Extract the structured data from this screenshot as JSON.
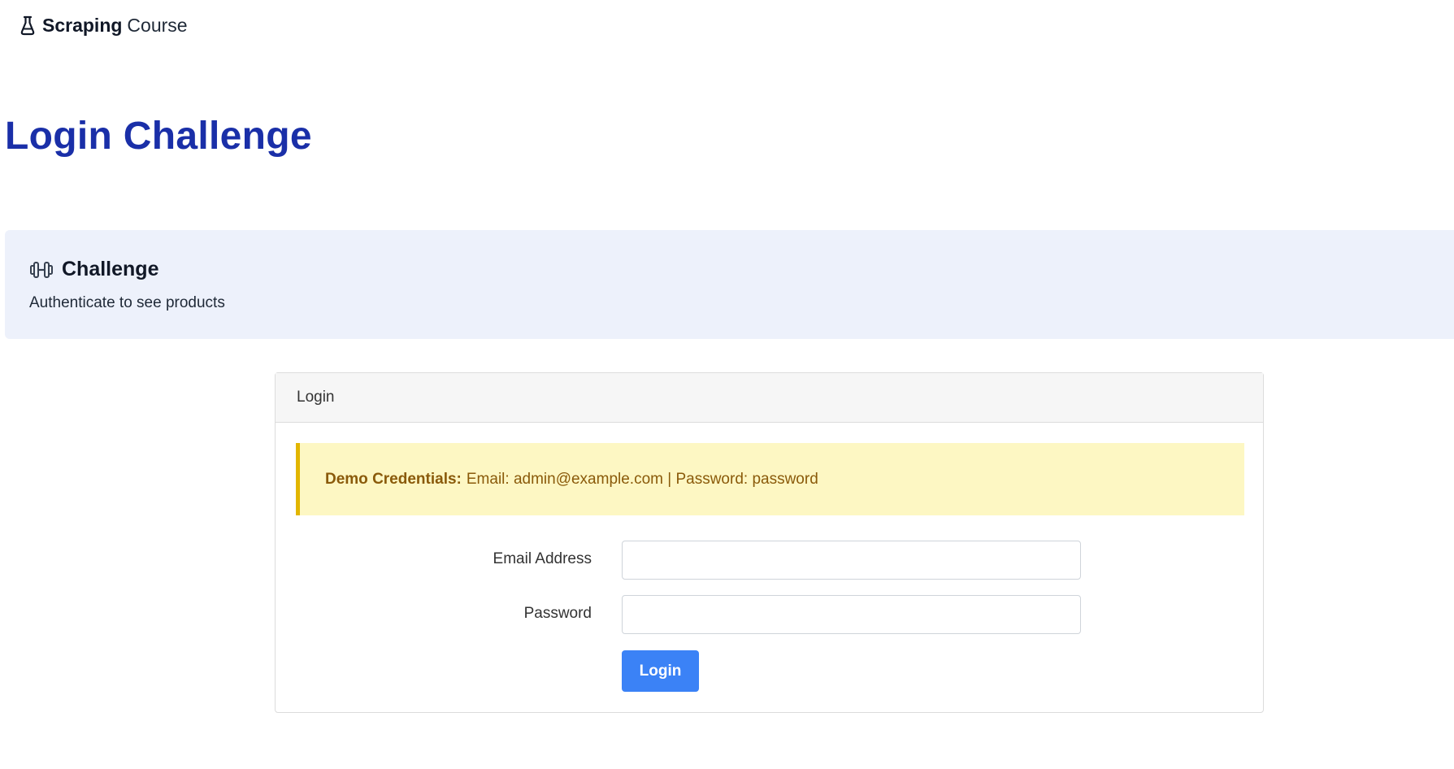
{
  "nav": {
    "logo_icon": "flask-icon",
    "brand_strong": "Scraping",
    "brand_light": "Course"
  },
  "page": {
    "title": "Login Challenge"
  },
  "challenge": {
    "icon": "dumbbell-icon",
    "heading": "Challenge",
    "description": "Authenticate to see products"
  },
  "login_card": {
    "header": "Login",
    "alert": {
      "label": "Demo Credentials:",
      "text": "Email: admin@example.com | Password: password"
    },
    "email": {
      "label": "Email Address",
      "value": "",
      "placeholder": ""
    },
    "password": {
      "label": "Password",
      "value": "",
      "placeholder": ""
    },
    "submit_label": "Login"
  },
  "colors": {
    "title": "#1a2fa8",
    "challenge_bg": "#edf1fb",
    "alert_bg": "#fdf7c3",
    "alert_border": "#e2b600",
    "alert_text": "#8a5a0a",
    "button_bg": "#3b82f6"
  }
}
